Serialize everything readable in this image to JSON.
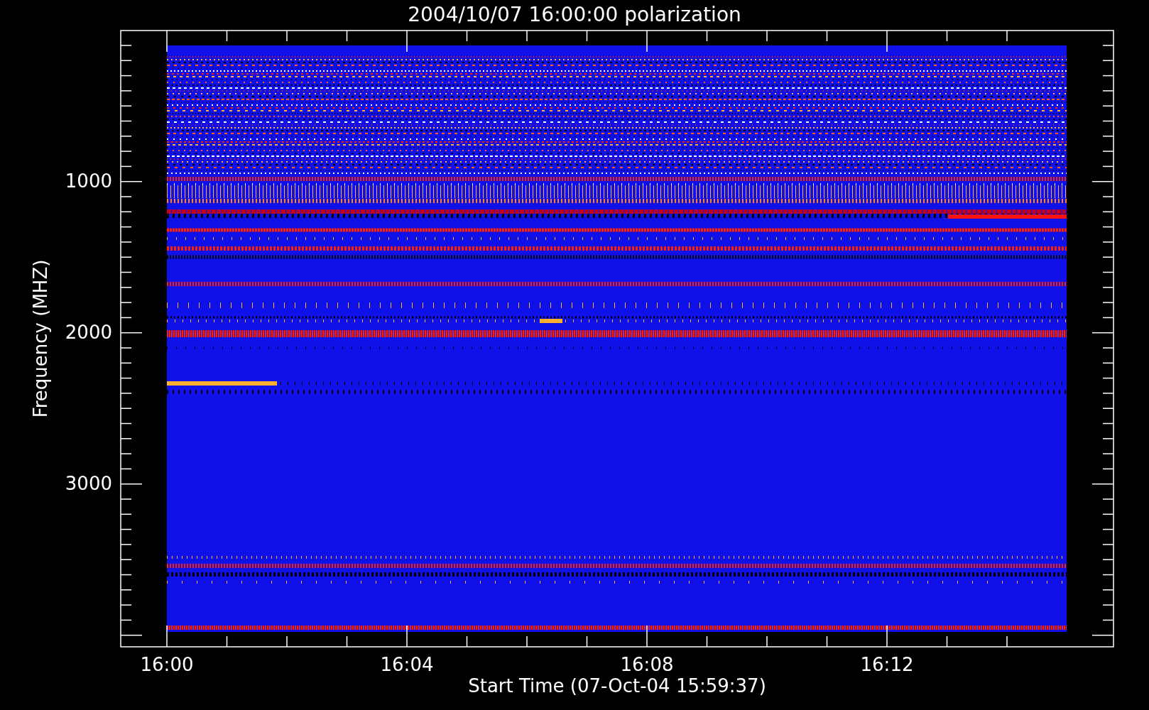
{
  "title": "2004/10/07 16:00:00 polarization",
  "y_axis": {
    "label": "Frequency (MHZ)",
    "ticks": [
      "1000",
      "2000",
      "3000"
    ]
  },
  "x_axis": {
    "label": "Start Time (07-Oct-04 15:59:37)",
    "ticks": [
      "16:00",
      "16:04",
      "16:08",
      "16:12"
    ]
  }
}
